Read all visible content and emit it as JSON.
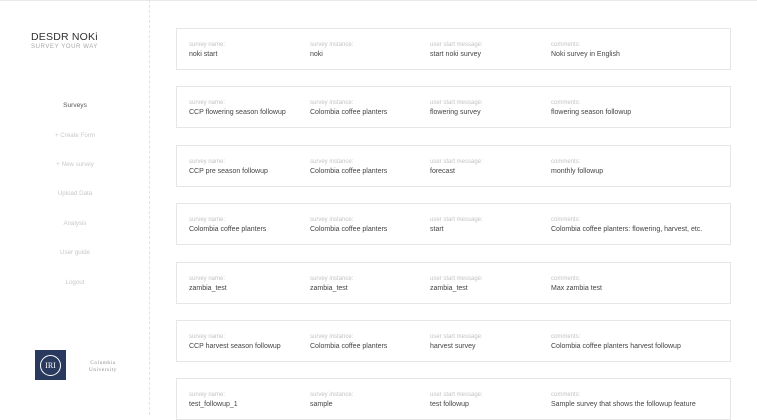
{
  "brand": {
    "title": "DESDR NOKi",
    "subtitle": "SURVEY YOUR WAY"
  },
  "nav": [
    {
      "label": "Surveys",
      "active": true
    },
    {
      "label": "+ Create Form",
      "active": false
    },
    {
      "label": "+ New survey",
      "active": false
    },
    {
      "label": "Upload Data",
      "active": false
    },
    {
      "label": "Analysis",
      "active": false
    },
    {
      "label": "User guide",
      "active": false
    },
    {
      "label": "Logout",
      "active": false
    }
  ],
  "footer": {
    "logo_text": "IRI",
    "university": [
      "Columbia",
      "University"
    ]
  },
  "field_labels": {
    "name": "survey name:",
    "instance": "survey instance:",
    "start": "user start message:",
    "comments": "comments:"
  },
  "surveys": [
    {
      "name": "noki start",
      "instance": "noki",
      "start": "start noki survey",
      "comments": "Noki survey in English"
    },
    {
      "name": "CCP flowering season followup",
      "instance": "Colombia coffee planters",
      "start": "flowering survey",
      "comments": "flowering season followup"
    },
    {
      "name": "CCP pre season followup",
      "instance": "Colombia coffee planters",
      "start": "forecast",
      "comments": "monthly followup"
    },
    {
      "name": "Colombia coffee planters",
      "instance": "Colombia coffee planters",
      "start": "start",
      "comments": "Colombia coffee planters: flowering, harvest, etc."
    },
    {
      "name": "zambia_test",
      "instance": "zambia_test",
      "start": "zambia_test",
      "comments": "Max zambia test"
    },
    {
      "name": "CCP harvest season followup",
      "instance": "Colombia coffee planters",
      "start": "harvest survey",
      "comments": "Colombia coffee planters harvest followup"
    },
    {
      "name": "test_followup_1",
      "instance": "sample",
      "start": "test followup",
      "comments": "Sample survey that shows the followup feature"
    }
  ]
}
